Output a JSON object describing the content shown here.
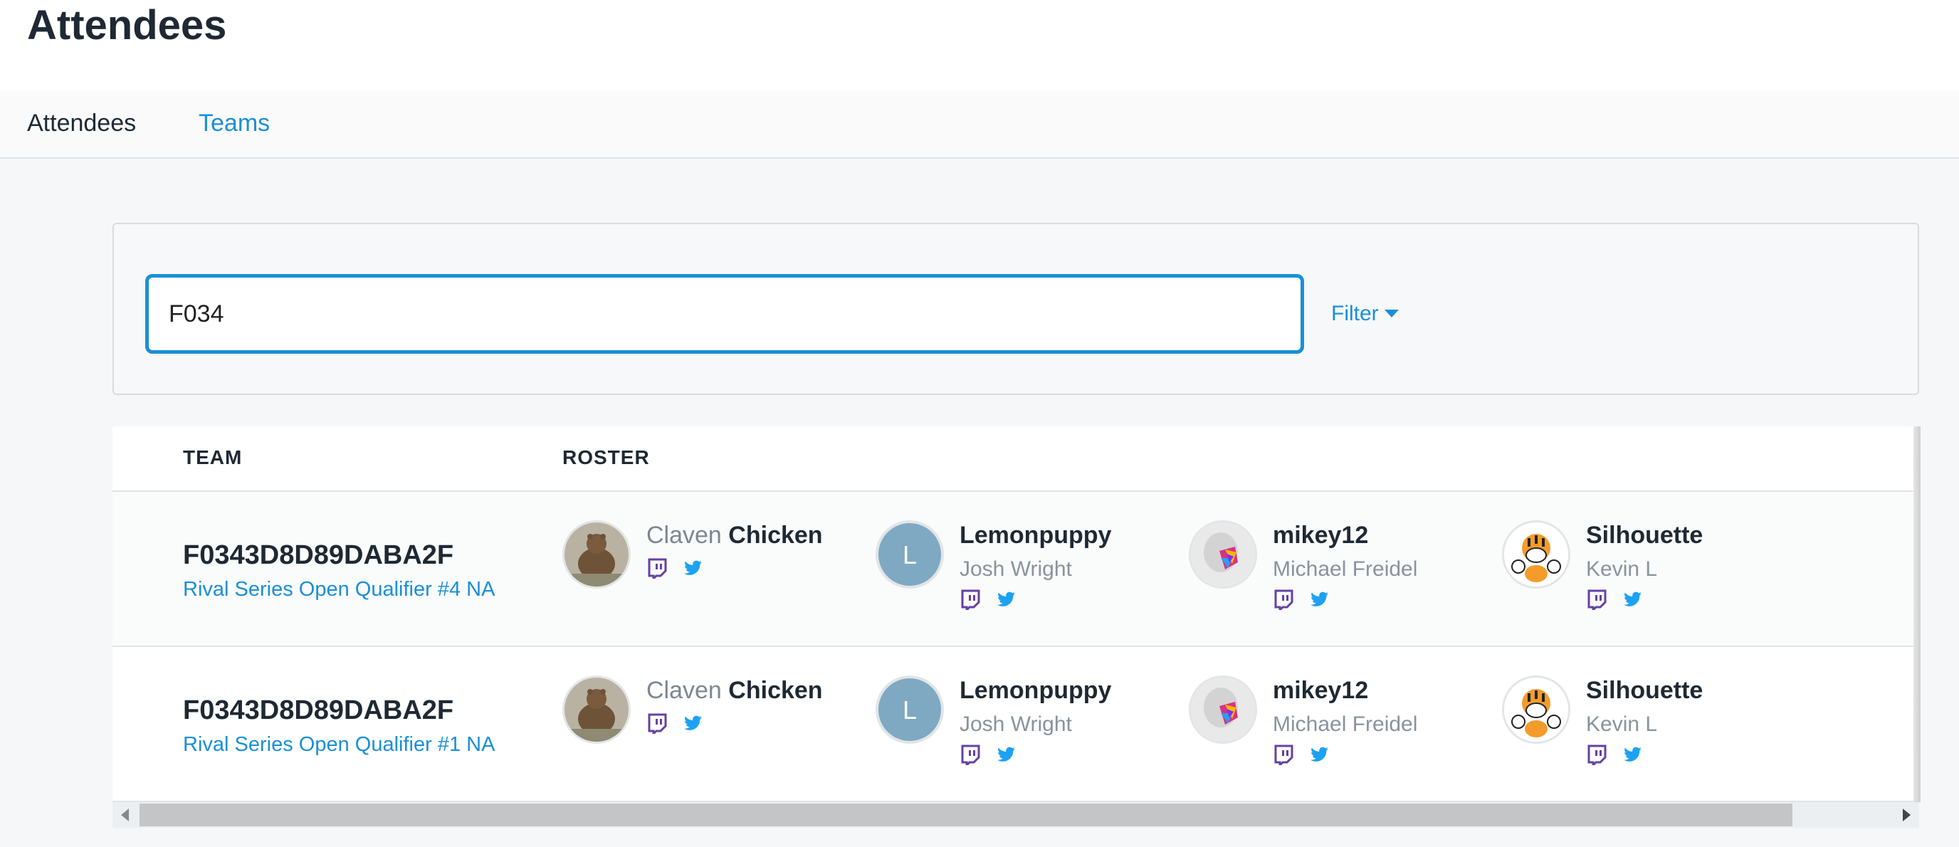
{
  "page": {
    "title": "Attendees"
  },
  "tabs": [
    {
      "label": "Attendees",
      "active": false
    },
    {
      "label": "Teams",
      "active": true
    }
  ],
  "search": {
    "value": "F034",
    "placeholder": ""
  },
  "filter": {
    "label": "Filter"
  },
  "table": {
    "headers": {
      "team": "TEAM",
      "roster": "ROSTER"
    },
    "rows": [
      {
        "team": "F0343D8D89DABA2F",
        "event": "Rival Series Open Qualifier #4 NA",
        "members": [
          {
            "prefix": "Claven",
            "name": "Chicken",
            "sub": "",
            "avatar": "bear"
          },
          {
            "prefix": "",
            "name": "Lemonpuppy",
            "sub": "Josh Wright",
            "avatar": "L"
          },
          {
            "prefix": "",
            "name": "mikey12",
            "sub": "Michael Freidel",
            "avatar": "helmet"
          },
          {
            "prefix": "",
            "name": "Silhouette",
            "sub": "Kevin L",
            "avatar": "tiger"
          }
        ]
      },
      {
        "team": "F0343D8D89DABA2F",
        "event": "Rival Series Open Qualifier #1 NA",
        "members": [
          {
            "prefix": "Claven",
            "name": "Chicken",
            "sub": "",
            "avatar": "bear"
          },
          {
            "prefix": "",
            "name": "Lemonpuppy",
            "sub": "Josh Wright",
            "avatar": "L"
          },
          {
            "prefix": "",
            "name": "mikey12",
            "sub": "Michael Freidel",
            "avatar": "helmet"
          },
          {
            "prefix": "",
            "name": "Silhouette",
            "sub": "Kevin L",
            "avatar": "tiger"
          }
        ]
      }
    ]
  },
  "colors": {
    "accent": "#1a8fd6",
    "twitch": "#6441a5",
    "twitter": "#1da1f2"
  }
}
